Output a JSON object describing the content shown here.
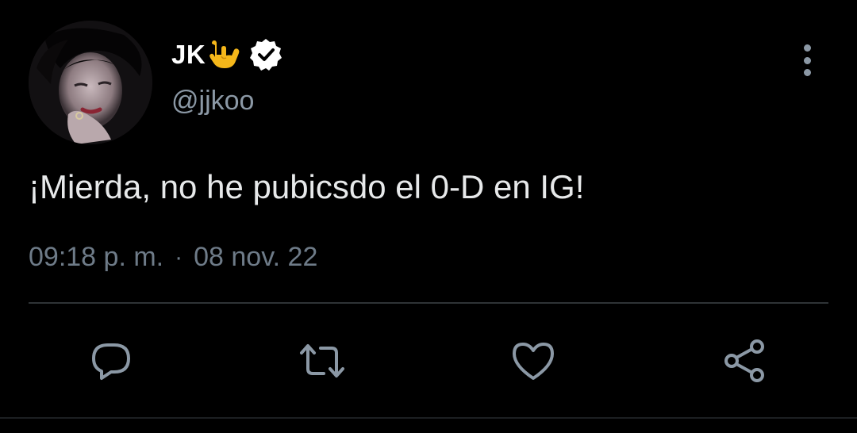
{
  "tweet": {
    "display_name": "JK",
    "handle": "@jjkoo",
    "text": "¡Mierda, no he pubicsdo el 0-D en IG!",
    "time": "09:18 p. m.",
    "separator": "·",
    "date": "08 nov. 22",
    "name_emoji_icon": "rock-on-hand-icon",
    "verified_icon": "verified-badge-icon"
  },
  "actions": [
    {
      "icon": "reply-icon"
    },
    {
      "icon": "retweet-icon"
    },
    {
      "icon": "like-icon"
    },
    {
      "icon": "share-icon"
    }
  ],
  "colors": {
    "background": "#000000",
    "primary_text": "#e7e9ea",
    "secondary_text": "#8b98a5",
    "emoji_yellow": "#f5b71a",
    "divider": "#2f3336"
  }
}
